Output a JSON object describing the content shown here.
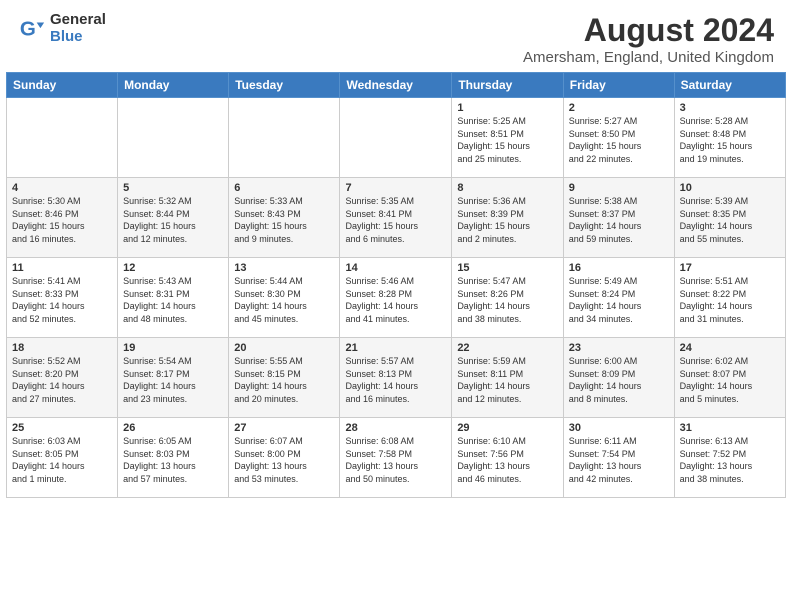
{
  "header": {
    "logo_line1": "General",
    "logo_line2": "Blue",
    "month": "August 2024",
    "location": "Amersham, England, United Kingdom"
  },
  "days_of_week": [
    "Sunday",
    "Monday",
    "Tuesday",
    "Wednesday",
    "Thursday",
    "Friday",
    "Saturday"
  ],
  "weeks": [
    [
      {
        "day": "",
        "info": ""
      },
      {
        "day": "",
        "info": ""
      },
      {
        "day": "",
        "info": ""
      },
      {
        "day": "",
        "info": ""
      },
      {
        "day": "1",
        "info": "Sunrise: 5:25 AM\nSunset: 8:51 PM\nDaylight: 15 hours\nand 25 minutes."
      },
      {
        "day": "2",
        "info": "Sunrise: 5:27 AM\nSunset: 8:50 PM\nDaylight: 15 hours\nand 22 minutes."
      },
      {
        "day": "3",
        "info": "Sunrise: 5:28 AM\nSunset: 8:48 PM\nDaylight: 15 hours\nand 19 minutes."
      }
    ],
    [
      {
        "day": "4",
        "info": "Sunrise: 5:30 AM\nSunset: 8:46 PM\nDaylight: 15 hours\nand 16 minutes."
      },
      {
        "day": "5",
        "info": "Sunrise: 5:32 AM\nSunset: 8:44 PM\nDaylight: 15 hours\nand 12 minutes."
      },
      {
        "day": "6",
        "info": "Sunrise: 5:33 AM\nSunset: 8:43 PM\nDaylight: 15 hours\nand 9 minutes."
      },
      {
        "day": "7",
        "info": "Sunrise: 5:35 AM\nSunset: 8:41 PM\nDaylight: 15 hours\nand 6 minutes."
      },
      {
        "day": "8",
        "info": "Sunrise: 5:36 AM\nSunset: 8:39 PM\nDaylight: 15 hours\nand 2 minutes."
      },
      {
        "day": "9",
        "info": "Sunrise: 5:38 AM\nSunset: 8:37 PM\nDaylight: 14 hours\nand 59 minutes."
      },
      {
        "day": "10",
        "info": "Sunrise: 5:39 AM\nSunset: 8:35 PM\nDaylight: 14 hours\nand 55 minutes."
      }
    ],
    [
      {
        "day": "11",
        "info": "Sunrise: 5:41 AM\nSunset: 8:33 PM\nDaylight: 14 hours\nand 52 minutes."
      },
      {
        "day": "12",
        "info": "Sunrise: 5:43 AM\nSunset: 8:31 PM\nDaylight: 14 hours\nand 48 minutes."
      },
      {
        "day": "13",
        "info": "Sunrise: 5:44 AM\nSunset: 8:30 PM\nDaylight: 14 hours\nand 45 minutes."
      },
      {
        "day": "14",
        "info": "Sunrise: 5:46 AM\nSunset: 8:28 PM\nDaylight: 14 hours\nand 41 minutes."
      },
      {
        "day": "15",
        "info": "Sunrise: 5:47 AM\nSunset: 8:26 PM\nDaylight: 14 hours\nand 38 minutes."
      },
      {
        "day": "16",
        "info": "Sunrise: 5:49 AM\nSunset: 8:24 PM\nDaylight: 14 hours\nand 34 minutes."
      },
      {
        "day": "17",
        "info": "Sunrise: 5:51 AM\nSunset: 8:22 PM\nDaylight: 14 hours\nand 31 minutes."
      }
    ],
    [
      {
        "day": "18",
        "info": "Sunrise: 5:52 AM\nSunset: 8:20 PM\nDaylight: 14 hours\nand 27 minutes."
      },
      {
        "day": "19",
        "info": "Sunrise: 5:54 AM\nSunset: 8:17 PM\nDaylight: 14 hours\nand 23 minutes."
      },
      {
        "day": "20",
        "info": "Sunrise: 5:55 AM\nSunset: 8:15 PM\nDaylight: 14 hours\nand 20 minutes."
      },
      {
        "day": "21",
        "info": "Sunrise: 5:57 AM\nSunset: 8:13 PM\nDaylight: 14 hours\nand 16 minutes."
      },
      {
        "day": "22",
        "info": "Sunrise: 5:59 AM\nSunset: 8:11 PM\nDaylight: 14 hours\nand 12 minutes."
      },
      {
        "day": "23",
        "info": "Sunrise: 6:00 AM\nSunset: 8:09 PM\nDaylight: 14 hours\nand 8 minutes."
      },
      {
        "day": "24",
        "info": "Sunrise: 6:02 AM\nSunset: 8:07 PM\nDaylight: 14 hours\nand 5 minutes."
      }
    ],
    [
      {
        "day": "25",
        "info": "Sunrise: 6:03 AM\nSunset: 8:05 PM\nDaylight: 14 hours\nand 1 minute."
      },
      {
        "day": "26",
        "info": "Sunrise: 6:05 AM\nSunset: 8:03 PM\nDaylight: 13 hours\nand 57 minutes."
      },
      {
        "day": "27",
        "info": "Sunrise: 6:07 AM\nSunset: 8:00 PM\nDaylight: 13 hours\nand 53 minutes."
      },
      {
        "day": "28",
        "info": "Sunrise: 6:08 AM\nSunset: 7:58 PM\nDaylight: 13 hours\nand 50 minutes."
      },
      {
        "day": "29",
        "info": "Sunrise: 6:10 AM\nSunset: 7:56 PM\nDaylight: 13 hours\nand 46 minutes."
      },
      {
        "day": "30",
        "info": "Sunrise: 6:11 AM\nSunset: 7:54 PM\nDaylight: 13 hours\nand 42 minutes."
      },
      {
        "day": "31",
        "info": "Sunrise: 6:13 AM\nSunset: 7:52 PM\nDaylight: 13 hours\nand 38 minutes."
      }
    ]
  ]
}
